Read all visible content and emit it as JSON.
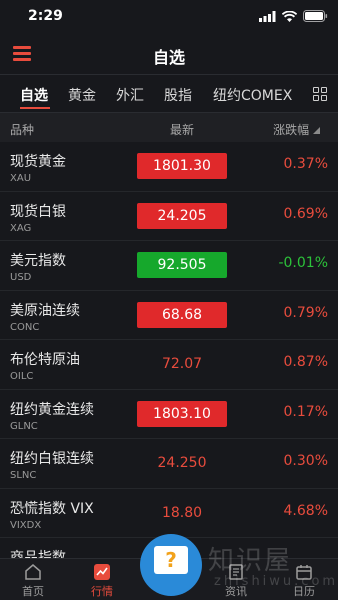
{
  "status": {
    "time": "2:29"
  },
  "header": {
    "title": "自选"
  },
  "tabs": [
    {
      "label": "自选",
      "active": true
    },
    {
      "label": "黄金"
    },
    {
      "label": "外汇"
    },
    {
      "label": "股指"
    },
    {
      "label": "纽约COMEX"
    }
  ],
  "columns": {
    "name": "品种",
    "latest": "最新",
    "change": "涨跌幅"
  },
  "rows": [
    {
      "name": "现货黄金",
      "code": "XAU",
      "price": "1801.30",
      "change": "0.37%"
    },
    {
      "name": "现货白银",
      "code": "XAG",
      "price": "24.205",
      "change": "0.69%"
    },
    {
      "name": "美元指数",
      "code": "USD",
      "price": "92.505",
      "change": "-0.01%"
    },
    {
      "name": "美原油连续",
      "code": "CONC",
      "price": "68.68",
      "change": "0.79%"
    },
    {
      "name": "布伦特原油",
      "code": "OILC",
      "price": "72.07",
      "change": "0.87%"
    },
    {
      "name": "纽约黄金连续",
      "code": "GLNC",
      "price": "1803.10",
      "change": "0.17%"
    },
    {
      "name": "纽约白银连续",
      "code": "SLNC",
      "price": "24.250",
      "change": "0.30%"
    },
    {
      "name": "恐慌指数 VIX",
      "code": "VIXDX",
      "price": "18.80",
      "change": "4.68%"
    },
    {
      "name": "商品指数",
      "code": "",
      "price": "",
      "change": ""
    }
  ],
  "tabbar": [
    {
      "label": "首页"
    },
    {
      "label": "行情",
      "active": true
    },
    {
      "label": "资讯"
    },
    {
      "label": "日历"
    }
  ],
  "watermark": {
    "text": "知识屋",
    "sub": "zhishiwu.com"
  },
  "colors": {
    "up": "#e84c3d",
    "down": "#2cc23a",
    "box_red": "#e0292b",
    "box_green": "#16a82c",
    "accent": "#e84c3d",
    "fab": "#2a8ad8"
  }
}
